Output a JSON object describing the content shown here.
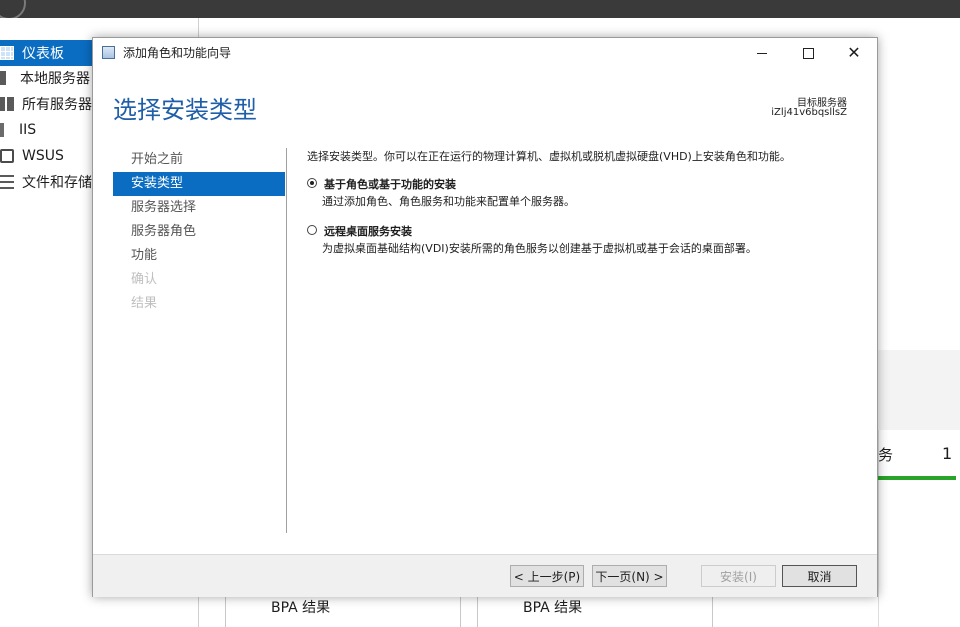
{
  "server_manager": {
    "nav_items": [
      {
        "label": "仪表板",
        "icon": "dashboard-icon",
        "active": true
      },
      {
        "label": "本地服务器",
        "icon": "server-icon"
      },
      {
        "label": "所有服务器",
        "icon": "servers-icon"
      },
      {
        "label": "IIS",
        "icon": "iis-icon"
      },
      {
        "label": "WSUS",
        "icon": "wsus-icon"
      },
      {
        "label": "文件和存储服",
        "icon": "file-storage-icon"
      }
    ],
    "tile_partial_text": "务",
    "tile_count": "1",
    "bpa_label_1": "BPA 结果",
    "bpa_label_2": "BPA 结果"
  },
  "wizard": {
    "window_title": "添加角色和功能向导",
    "heading": "选择安装类型",
    "target_server_label": "目标服务器",
    "target_server_name": "iZlj41v6bqsllsZ",
    "steps": [
      {
        "label": "开始之前",
        "state": "normal"
      },
      {
        "label": "安装类型",
        "state": "active"
      },
      {
        "label": "服务器选择",
        "state": "normal"
      },
      {
        "label": "服务器角色",
        "state": "normal"
      },
      {
        "label": "功能",
        "state": "normal"
      },
      {
        "label": "确认",
        "state": "disabled"
      },
      {
        "label": "结果",
        "state": "disabled"
      }
    ],
    "description": "选择安装类型。你可以在正在运行的物理计算机、虚拟机或脱机虚拟硬盘(VHD)上安装角色和功能。",
    "options": [
      {
        "title": "基于角色或基于功能的安装",
        "desc": "通过添加角色、角色服务和功能来配置单个服务器。",
        "checked": true
      },
      {
        "title": "远程桌面服务安装",
        "desc": "为虚拟桌面基础结构(VDI)安装所需的角色服务以创建基于虚拟机或基于会话的桌面部署。",
        "checked": false
      }
    ],
    "buttons": {
      "previous": "< 上一步(P)",
      "next": "下一页(N) >",
      "install": "安装(I)",
      "cancel": "取消"
    }
  },
  "colors": {
    "accent": "#0a6dc2",
    "heading": "#1f5ea8",
    "status_green": "#29a329"
  }
}
